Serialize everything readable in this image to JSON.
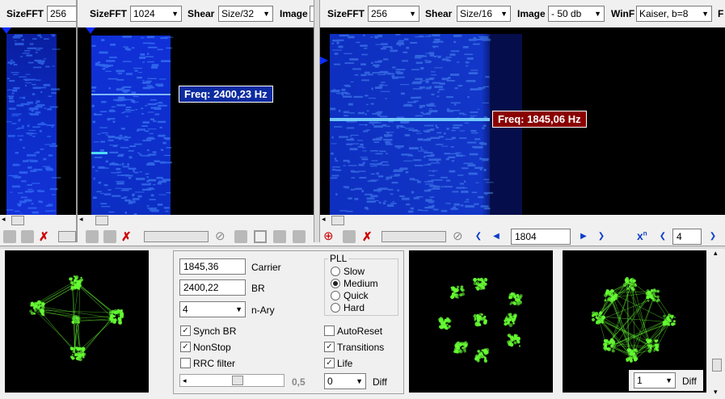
{
  "colors": {
    "spectrum_bg": "#000000",
    "waterfall_blue": "#1030d8",
    "freq_tag1_bg": "#0c2ba0",
    "freq_tag1_fg": "#ffffff",
    "freq_tag2_bg": "#8a0000",
    "freq_tag2_fg": "#ffffff",
    "constellation_green": "#66ff33"
  },
  "pane1": {
    "sizefft_label": "SizeFFT",
    "sizefft_value": "256"
  },
  "pane2": {
    "sizefft_label": "SizeFFT",
    "sizefft_value": "1024",
    "shear_label": "Shear",
    "shear_value": "Size/32",
    "image_label": "Image",
    "freq_tag": "Freq: 2400,23 Hz"
  },
  "pane3": {
    "sizefft_label": "SizeFFT",
    "sizefft_value": "256",
    "shear_label": "Shear",
    "shear_value": "Size/16",
    "image_label": "Image",
    "image_value": "- 50 db",
    "winf_label": "WinF",
    "winf_value": "Kaiser, b=8",
    "cut_label": "F",
    "freq_tag": "Freq: 1845,06 Hz",
    "position_value": "1804",
    "power_label": "x",
    "power_sup": "n",
    "power_value": "4"
  },
  "controls": {
    "carrier_value": "1845,36",
    "carrier_label": "Carrier",
    "br_value": "2400,22",
    "br_label": "BR",
    "nary_value": "4",
    "nary_label": "n-Ary",
    "synch_br_label": "Synch BR",
    "synch_br_checked": true,
    "nonstop_label": "NonStop",
    "nonstop_checked": true,
    "rrc_label": "RRC filter",
    "rrc_checked": false,
    "slider_value": "0,5",
    "slider_level": 0.5,
    "pll_title": "PLL",
    "pll_options": [
      "Slow",
      "Medium",
      "Quick",
      "Hard"
    ],
    "pll_selected": "Medium",
    "autoreset_label": "AutoReset",
    "autoreset_checked": false,
    "transitions_label": "Transitions",
    "transitions_checked": true,
    "life_label": "Life",
    "life_checked": true,
    "diff_value": "0",
    "diff_label": "Diff"
  },
  "constellation3": {
    "diff_value": "1",
    "diff_label": "Diff"
  },
  "icons": {
    "play_left": "prev-arrow-icon",
    "play_right": "next-arrow-icon",
    "zoom": "zoom-icon",
    "delete": "delete-icon",
    "block": "block-icon"
  }
}
